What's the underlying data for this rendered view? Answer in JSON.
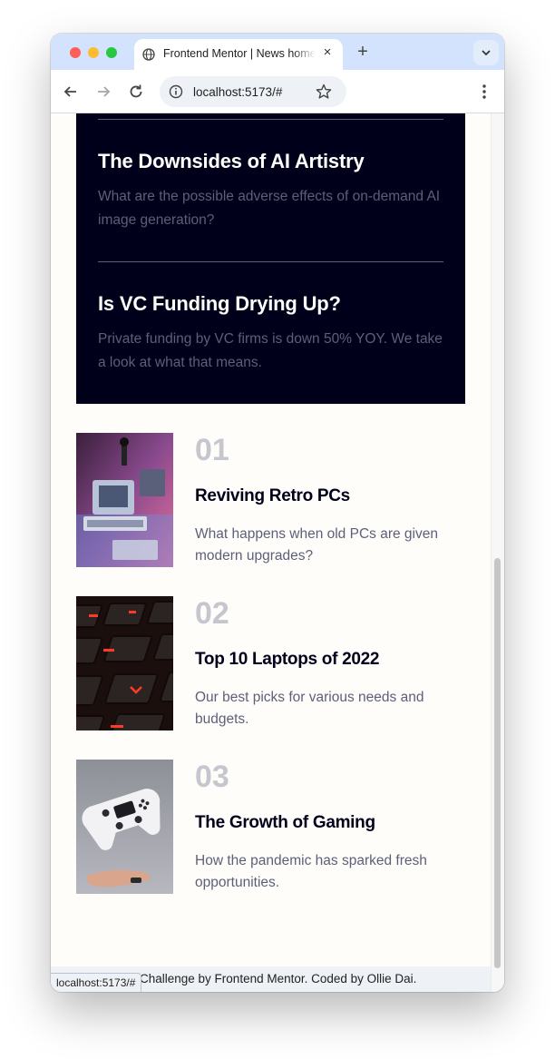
{
  "browser": {
    "tab_title": "Frontend Mentor | News homepage",
    "tab_close": "×",
    "new_tab": "+",
    "url": "localhost:5173/#",
    "status_url": "localhost:5173/#"
  },
  "new_section": {
    "items": [
      {
        "title": "The Downsides of AI Artistry",
        "description": "What are the possible adverse effects of on-demand AI image generation?"
      },
      {
        "title": "Is VC Funding Drying Up?",
        "description": "Private funding by VC firms is down 50% YOY. We take a look at what that means."
      }
    ]
  },
  "articles": [
    {
      "number": "01",
      "title": "Reviving Retro PCs",
      "description": "What happens when old PCs are given modern upgrades?"
    },
    {
      "number": "02",
      "title": "Top 10 Laptops of 2022",
      "description": "Our best picks for various needs and budgets."
    },
    {
      "number": "03",
      "title": "The Growth of Gaming",
      "description": "How the pandemic has sparked fresh opportunities."
    }
  ],
  "footer": {
    "text": "Challenge by Frontend Mentor. Coded by Ollie Dai."
  },
  "colors": {
    "dark_box": "#00001a",
    "muted_text": "#5d5f79",
    "number_gray": "#c5c6ce",
    "tab_strip": "#d3e3fd"
  }
}
